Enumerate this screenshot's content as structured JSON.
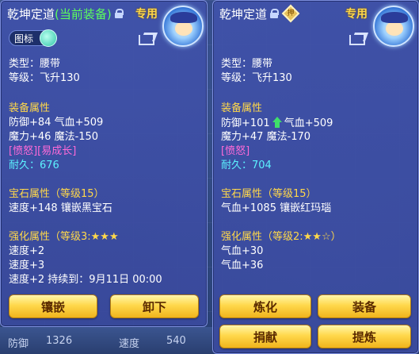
{
  "left_panel": {
    "name": "乾坤定道",
    "equipped_tag": "(当前装备)",
    "exclusive": "专用",
    "icon_toggle_label": "图标",
    "type": "类型：腰带",
    "level": "等级：飞升130",
    "equip_attr_title": "装备属性",
    "attr_line1": "防御+84 气血+509",
    "attr_line2": "魔力+46 魔法-150",
    "special": "[愤怒][易成长]",
    "durability": "耐久：676",
    "gem_title": "宝石属性（等级15）",
    "gem_line": "速度+148 镶嵌黑宝石",
    "enhance_title": "强化属性（等级3:★★★",
    "enhance_lines": [
      "速度+2",
      "速度+3",
      "速度+2    持续到：9月11日 00:00"
    ],
    "buttons": [
      "镶嵌",
      "卸下"
    ]
  },
  "right_panel": {
    "name": "乾坤定道",
    "exclusive": "专用",
    "type": "类型：腰带",
    "level": "等级：飞升130",
    "equip_attr_title": "装备属性",
    "attr_line1_a": "防御+101",
    "attr_line1_b": "气血+509",
    "attr_line2": "魔力+47 魔法-170",
    "special": "[愤怒]",
    "durability": "耐久：704",
    "gem_title": "宝石属性（等级15）",
    "gem_line": "气血+1085 镶嵌红玛瑙",
    "enhance_title": "强化属性（等级2:★★☆）",
    "enhance_lines": [
      "气血+30",
      "气血+36"
    ],
    "buttons": [
      "炼化",
      "装备",
      "捐献",
      "提炼"
    ]
  },
  "background": {
    "stat_a": "防御",
    "stat_a_value": "1326",
    "stat_b": "速度",
    "stat_b_value": "540"
  }
}
